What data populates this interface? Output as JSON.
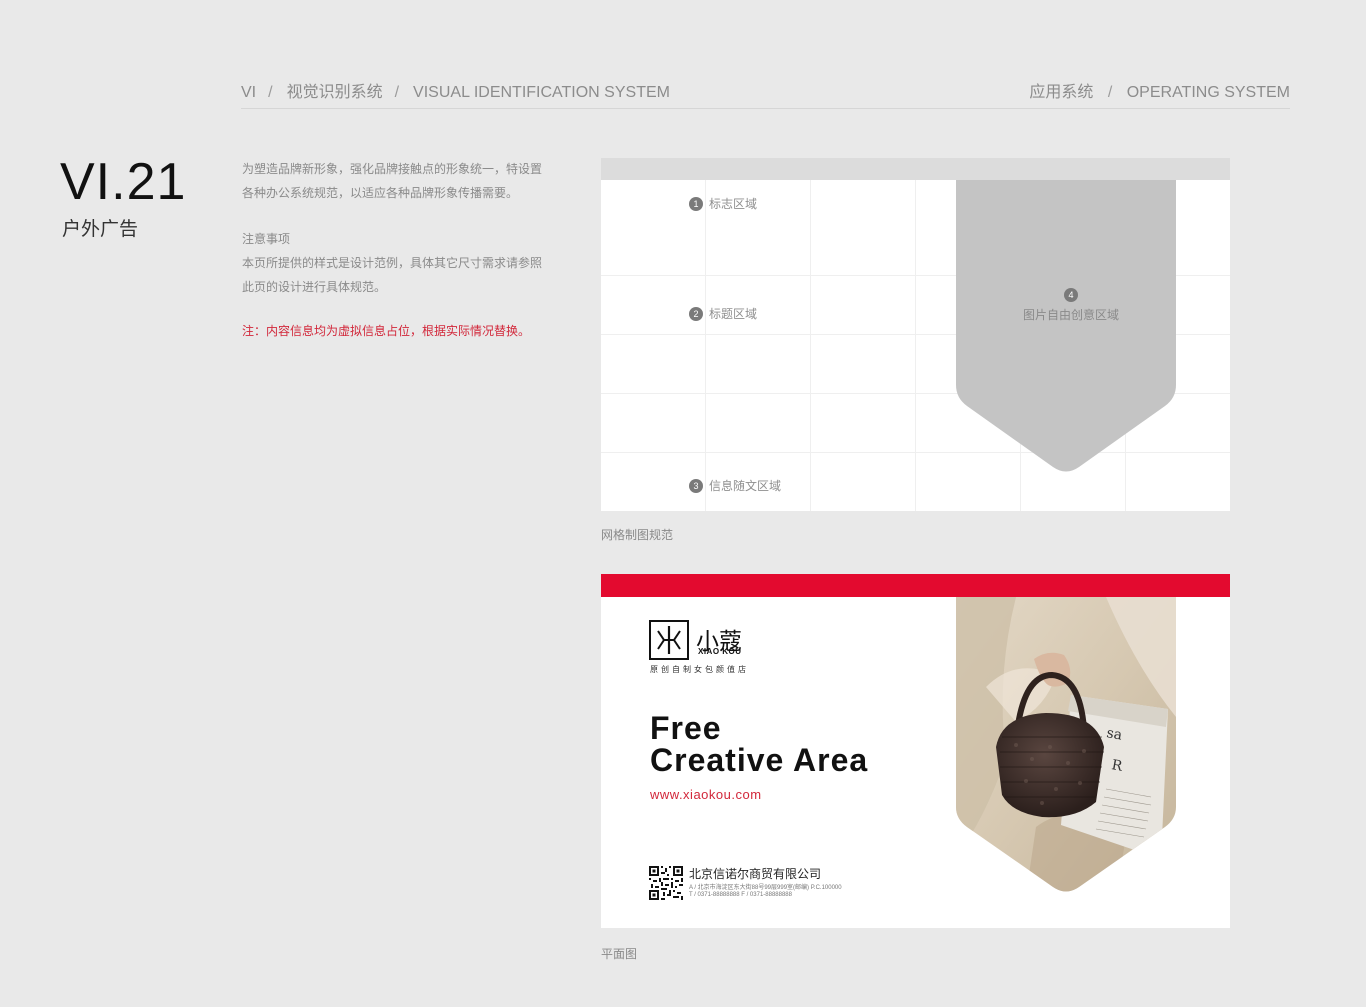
{
  "header": {
    "crumbs": [
      "VI",
      "视觉识别系统",
      "VISUAL IDENTIFICATION SYSTEM"
    ],
    "separator": "/",
    "section_cn": "应用系统",
    "section_en": "OPERATING SYSTEM"
  },
  "chapter": {
    "number": "VI.21",
    "title": "户外广告"
  },
  "description": {
    "intro": "为塑造品牌新形象，强化品牌接触点的形象统一，特设置各种办公系统规范，以适应各种品牌形象传播需要。",
    "notes_title": "注意事项",
    "notes_body": "本页所提供的样式是设计范例，具体其它尺寸需求请参照此页的设计进行具体规范。",
    "disclaimer": "注：内容信息均为虚拟信息占位，根据实际情况替换。"
  },
  "grid_diagram": {
    "zones": [
      {
        "num": "1",
        "label": "标志区域"
      },
      {
        "num": "2",
        "label": "标题区域"
      },
      {
        "num": "3",
        "label": "信息随文区域"
      },
      {
        "num": "4",
        "label": "图片自由创意区域"
      }
    ],
    "caption": "网格制图规范",
    "colors": {
      "topbar": "#dcdcdc",
      "image_area": "#c4c4c4"
    }
  },
  "billboard": {
    "brand_cn": "小蔻",
    "brand_en": "XIAO KOU",
    "tagline": "原创自制女包颜值店",
    "headline_line1": "Free",
    "headline_line2": "Creative Area",
    "url": "www.xiaokou.com",
    "company": "北京信诺尔商贸有限公司",
    "address": "A / 北京市海淀区东大街88号99层999室(邮编) P.C.100000",
    "phone": "T / 0371-88888888      F / 0371-88888888",
    "caption": "平面图",
    "colors": {
      "accent_red": "#e30a2f",
      "url_red": "#d2273a"
    }
  }
}
